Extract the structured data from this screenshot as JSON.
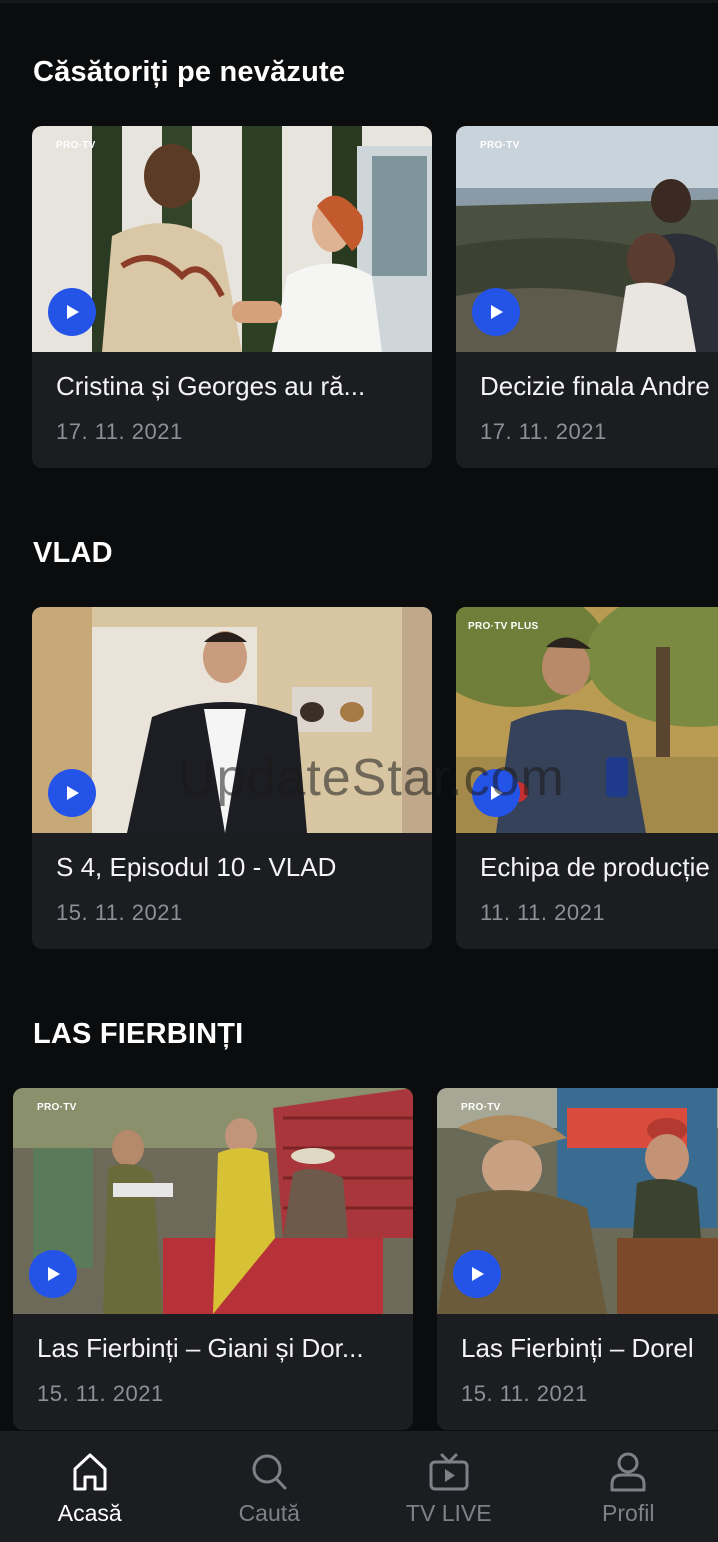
{
  "sections": [
    {
      "title": "Căsătoriți pe nevăzute",
      "cards": [
        {
          "title": "Cristina și Georges au ră...",
          "date": "17. 11. 2021",
          "channel": "PRO·TV"
        },
        {
          "title": "Decizie finala Andre",
          "date": "17. 11. 2021",
          "channel": "PRO·TV"
        }
      ]
    },
    {
      "title": "VLAD",
      "cards": [
        {
          "title": "S 4, Episodul 10 - VLAD",
          "date": "15. 11. 2021",
          "channel": ""
        },
        {
          "title": "Echipa de producție",
          "date": "11. 11. 2021",
          "channel": "PRO·TV PLUS"
        }
      ]
    },
    {
      "title": "LAS FIERBINȚI",
      "cards": [
        {
          "title": "Las Fierbinți – Giani și Dor...",
          "date": "15. 11. 2021",
          "channel": "PRO·TV"
        },
        {
          "title": "Las Fierbinți – Dorel",
          "date": "15. 11. 2021",
          "channel": "PRO·TV"
        }
      ]
    }
  ],
  "watermark": "UpdateStar.com",
  "nav": {
    "items": [
      {
        "label": "Acasă",
        "icon": "home-icon",
        "active": true
      },
      {
        "label": "Caută",
        "icon": "search-icon",
        "active": false
      },
      {
        "label": "TV LIVE",
        "icon": "tv-icon",
        "active": false
      },
      {
        "label": "Profil",
        "icon": "profile-icon",
        "active": false
      }
    ]
  },
  "colors": {
    "background": "#0b0c0e",
    "card": "#1b1d21",
    "accent_play": "#2453e8",
    "date_text": "#8d9096",
    "nav_inactive": "#7e8187"
  }
}
